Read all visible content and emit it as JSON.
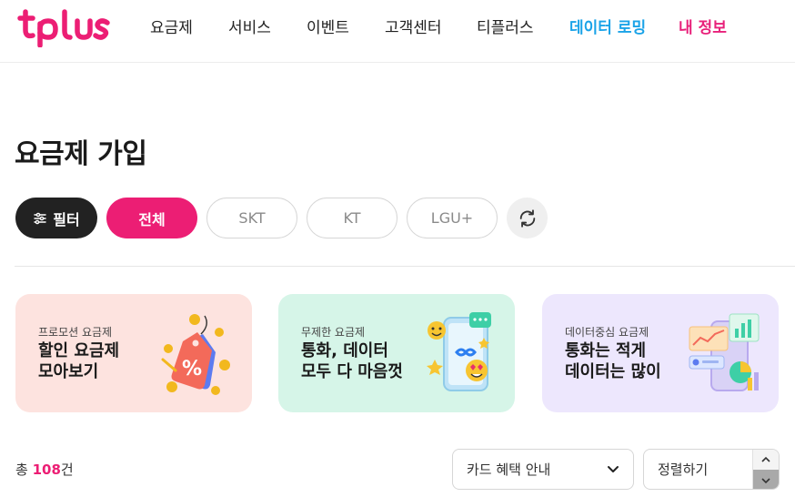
{
  "brand": {
    "logo_text": "tplus",
    "accent": "#ec1e74"
  },
  "nav": {
    "items": [
      {
        "label": "요금제"
      },
      {
        "label": "서비스"
      },
      {
        "label": "이벤트"
      },
      {
        "label": "고객센터"
      },
      {
        "label": "티플러스"
      },
      {
        "label": "데이터 로밍"
      },
      {
        "label": "내 정보"
      }
    ]
  },
  "page": {
    "title": "요금제 가입"
  },
  "filters": {
    "filter_label": "필터",
    "chips": [
      "전체",
      "SKT",
      "KT",
      "LGU+"
    ],
    "selected": "전체",
    "refresh_icon": "refresh-icon"
  },
  "cards": [
    {
      "subtitle": "프로모션 요금제",
      "title_line1": "할인 요금제",
      "title_line2": "모아보기",
      "icon": "discount-tag-icon"
    },
    {
      "subtitle": "무제한 요금제",
      "title_line1": "통화, 데이터",
      "title_line2": "모두 다 마음껏",
      "icon": "smartphone-emoji-icon"
    },
    {
      "subtitle": "데이터중심 요금제",
      "title_line1": "통화는 적게",
      "title_line2": "데이터는 많이",
      "icon": "data-chart-icon"
    }
  ],
  "list": {
    "total_prefix": "총 ",
    "total_count": "108",
    "total_suffix": "건",
    "card_select_value": "카드 혜택 안내",
    "sort_select_value": "정렬하기"
  }
}
